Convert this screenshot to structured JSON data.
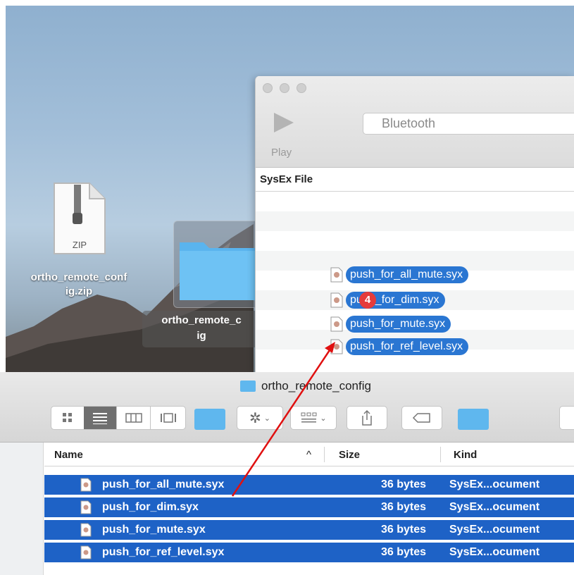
{
  "desktop": {
    "zip_badge": "ZIP",
    "zip_name_line1": "ortho_remote_conf",
    "zip_name_line2": "ig.zip",
    "folder_name_line1": "ortho_remote_c",
    "folder_name_line2": "ig"
  },
  "app_window": {
    "play_label": "Play",
    "device_field": "Bluetooth",
    "column_header": "SysEx File"
  },
  "drag": {
    "badge_count": "4",
    "items": [
      "push_for_all_mute.syx",
      "pu",
      "_for_dim.syx",
      "push_for_mute.syx",
      "push_for_ref_level.syx"
    ]
  },
  "finder": {
    "title": "ortho_remote_config",
    "columns": {
      "name": "Name",
      "size": "Size",
      "kind": "Kind",
      "sort_indicator": "^"
    },
    "rows": [
      {
        "name": "push_for_all_mute.syx",
        "size": "36 bytes",
        "kind": "SysEx...ocument"
      },
      {
        "name": "push_for_dim.syx",
        "size": "36 bytes",
        "kind": "SysEx...ocument"
      },
      {
        "name": "push_for_mute.syx",
        "size": "36 bytes",
        "kind": "SysEx...ocument"
      },
      {
        "name": "push_for_ref_level.syx",
        "size": "36 bytes",
        "kind": "SysEx...ocument"
      }
    ]
  },
  "colors": {
    "selection": "#1e62c6",
    "drag_pill": "#2a76d2",
    "badge": "#e53b3b",
    "arrow": "#e01010",
    "folder": "#5fb7ee"
  }
}
